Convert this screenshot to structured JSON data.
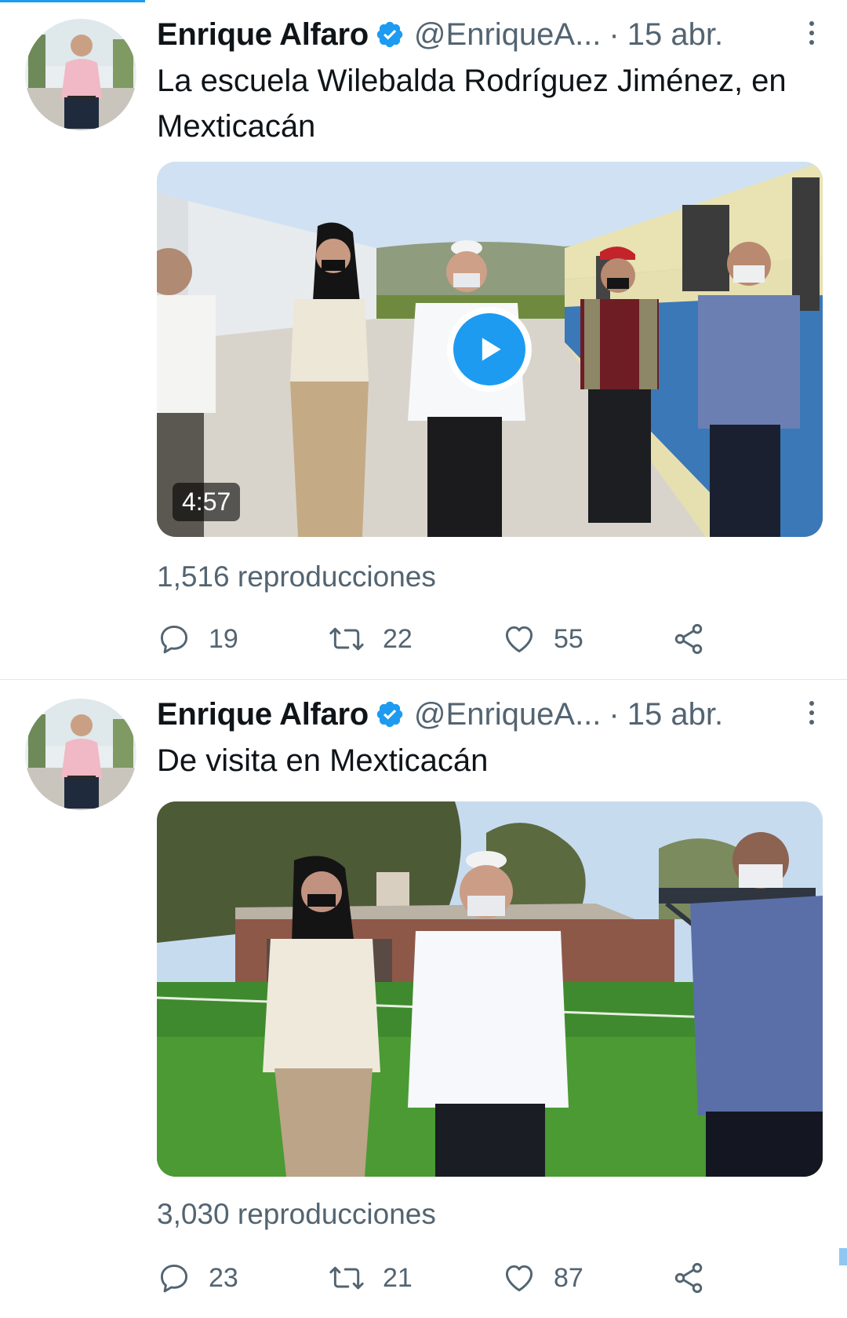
{
  "tweets": [
    {
      "author": {
        "name": "Enrique Alfaro",
        "handle": "@EnriqueA...",
        "verified": true
      },
      "separator": "·",
      "date": "15 abr.",
      "text": "La escuela Wilebalda Rodríguez Jiménez, en Mexticacán",
      "media": {
        "type": "video",
        "duration": "4:57",
        "show_play_button": true
      },
      "views": "1,516 reproducciones",
      "stats": {
        "replies": "19",
        "retweets": "22",
        "likes": "55"
      }
    },
    {
      "author": {
        "name": "Enrique Alfaro",
        "handle": "@EnriqueA...",
        "verified": true
      },
      "separator": "·",
      "date": "15 abr.",
      "text": "De visita en Mexticacán",
      "media": {
        "type": "video",
        "show_play_button": false
      },
      "views": "3,030 reproducciones",
      "stats": {
        "replies": "23",
        "retweets": "21",
        "likes": "87"
      }
    }
  ],
  "colors": {
    "accent": "#1d9bf0",
    "text_primary": "#0f1419",
    "text_secondary": "#536471",
    "divider": "#e3e6e8"
  },
  "icons": {
    "verified": "verified-badge-icon",
    "more": "more-vertical-icon",
    "reply": "reply-icon",
    "retweet": "retweet-icon",
    "like": "heart-icon",
    "share": "share-icon",
    "play": "play-icon"
  }
}
